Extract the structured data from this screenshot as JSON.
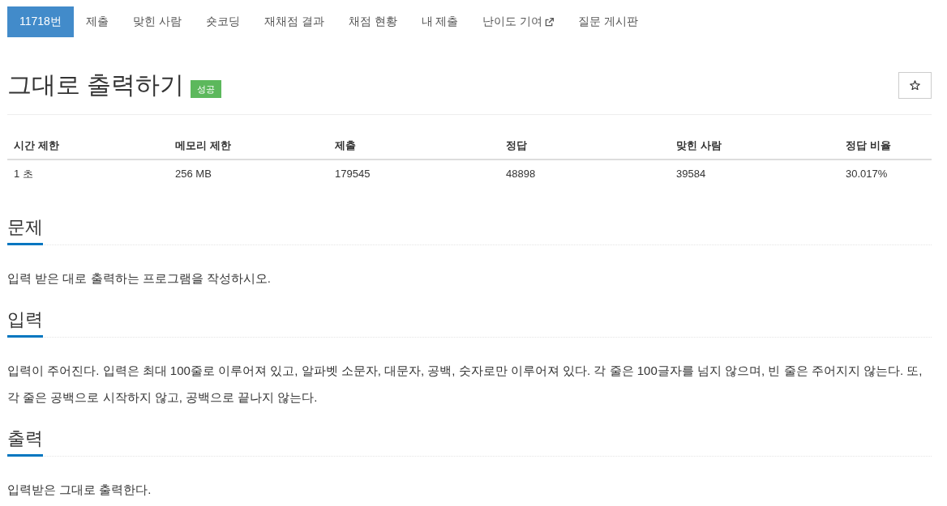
{
  "tabs": [
    {
      "label": "11718번",
      "selected": true,
      "external": false
    },
    {
      "label": "제출",
      "selected": false,
      "external": false
    },
    {
      "label": "맞힌 사람",
      "selected": false,
      "external": false
    },
    {
      "label": "숏코딩",
      "selected": false,
      "external": false
    },
    {
      "label": "재채점 결과",
      "selected": false,
      "external": false
    },
    {
      "label": "채점 현황",
      "selected": false,
      "external": false
    },
    {
      "label": "내 제출",
      "selected": false,
      "external": false
    },
    {
      "label": "난이도 기여",
      "selected": false,
      "external": true
    },
    {
      "label": "질문 게시판",
      "selected": false,
      "external": false
    }
  ],
  "problem": {
    "title": "그대로 출력하기",
    "badge": "성공",
    "starred": false
  },
  "info_table": {
    "columns": [
      "시간 제한",
      "메모리 제한",
      "제출",
      "정답",
      "맞힌 사람",
      "정답 비율"
    ],
    "rows": [
      [
        "1 초",
        "256 MB",
        "179545",
        "48898",
        "39584",
        "30.017%"
      ]
    ]
  },
  "sections": [
    {
      "heading": "문제",
      "paragraphs": [
        "입력 받은 대로 출력하는 프로그램을 작성하시오."
      ]
    },
    {
      "heading": "입력",
      "paragraphs": [
        "입력이 주어진다. 입력은 최대 100줄로 이루어져 있고, 알파벳 소문자, 대문자, 공백, 숫자로만 이루어져 있다. 각 줄은 100글자를 넘지 않으며, 빈 줄은 주어지지 않는다. 또, 각 줄은 공백으로 시작하지 않고, 공백으로 끝나지 않는다."
      ]
    },
    {
      "heading": "출력",
      "paragraphs": [
        "입력받은 그대로 출력한다."
      ]
    }
  ]
}
